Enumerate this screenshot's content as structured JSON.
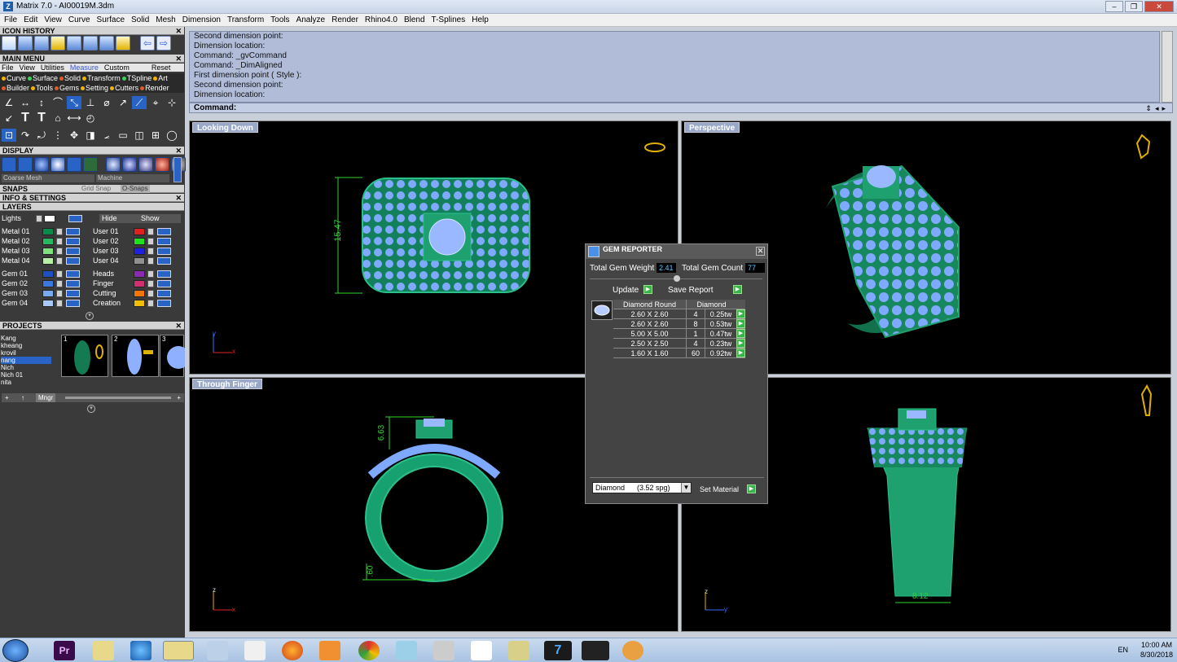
{
  "app": {
    "title": "Matrix 7.0 - AI00019M.3dm",
    "icon": "Z"
  },
  "menu": [
    "File",
    "Edit",
    "View",
    "Curve",
    "Surface",
    "Solid",
    "Mesh",
    "Dimension",
    "Transform",
    "Tools",
    "Analyze",
    "Render",
    "Rhino4.0",
    "Blend",
    "T-Splines",
    "Help"
  ],
  "panels": {
    "icon_history": "ICON HISTORY",
    "main_menu": "MAIN MENU",
    "display": "DISPLAY",
    "snaps": "SNAPS",
    "info": "INFO & SETTINGS",
    "layers": "LAYERS",
    "projects": "PROJECTS"
  },
  "main_menu_tabs": {
    "file": "File",
    "view": "View",
    "utilities": "Utilities",
    "measure": "Measure",
    "custom": "Custom",
    "reset": "Reset"
  },
  "main_menu_row1": [
    "Curve",
    "Surface",
    "Solid",
    "Transform",
    "TSpline",
    "Art"
  ],
  "main_menu_row2": [
    "Builder",
    "Tools",
    "Gems",
    "Setting",
    "Cutters",
    "Render"
  ],
  "display": {
    "mesh_label": "Coarse Mesh",
    "material_label": "Machine"
  },
  "snaps": {
    "grid": "Grid Snap",
    "osnaps": "O-Snaps"
  },
  "layers": {
    "lights": "Lights",
    "hide": "Hide",
    "show": "Show",
    "left": [
      {
        "name": "Metal 01",
        "color": "#0a8a4a"
      },
      {
        "name": "Metal 02",
        "color": "#28b860"
      },
      {
        "name": "Metal 03",
        "color": "#7fe07f"
      },
      {
        "name": "Metal 04",
        "color": "#b8f0a8"
      },
      {
        "name": "Gem 01",
        "color": "#2050c0"
      },
      {
        "name": "Gem 02",
        "color": "#3a78e0"
      },
      {
        "name": "Gem 03",
        "color": "#78a8f0"
      },
      {
        "name": "Gem 04",
        "color": "#a8c8f8"
      }
    ],
    "right": [
      {
        "name": "User 01",
        "color": "#e02020"
      },
      {
        "name": "User 02",
        "color": "#20e020"
      },
      {
        "name": "User 03",
        "color": "#2020e0"
      },
      {
        "name": "User 04",
        "color": "#909090"
      },
      {
        "name": "Heads",
        "color": "#8a2ab0"
      },
      {
        "name": "Finger",
        "color": "#d03070"
      },
      {
        "name": "Cutting",
        "color": "#f07800"
      },
      {
        "name": "Creation",
        "color": "#f0c000"
      }
    ]
  },
  "projects": {
    "items": [
      "Kang",
      "kheang",
      "krovil",
      "nang",
      "Nich",
      "Nich 01",
      "nita"
    ],
    "selected_index": 3,
    "thumb_numbers": [
      "1",
      "2",
      "3"
    ],
    "manager": "Mngr"
  },
  "command_history": [
    "Second dimension point:",
    "Dimension location:",
    "Command: _gvCommand",
    "Command: _DimAligned",
    "First dimension point ( Style ):",
    "Second dimension point:",
    "Dimension location:"
  ],
  "command_prompt": "Command:",
  "viewports": {
    "top_left": "Looking Down",
    "top_right": "Perspective",
    "bottom_left": "Through Finger",
    "bottom_right": ""
  },
  "dimensions": {
    "looking_down": "15.47",
    "through_top": "6.63",
    "through_bottom": ".60",
    "side_width": "8.12"
  },
  "axes": {
    "y": "y",
    "x": "x",
    "z": "z"
  },
  "gem_reporter": {
    "title": "GEM REPORTER",
    "weight_label": "Total Gem Weight",
    "weight_value": "2.41",
    "count_label": "Total Gem Count",
    "count_value": "77",
    "update": "Update",
    "save": "Save Report",
    "col_shape": "Diamond Round",
    "col_type": "Diamond",
    "rows": [
      {
        "size": "2.60 X 2.60",
        "count": "4",
        "tw": "0.25tw"
      },
      {
        "size": "2.60 X 2.60",
        "count": "8",
        "tw": "0.53tw"
      },
      {
        "size": "5.00 X 5.00",
        "count": "1",
        "tw": "0.47tw"
      },
      {
        "size": "2.50 X 2.50",
        "count": "4",
        "tw": "0.23tw"
      },
      {
        "size": "1.60 X 1.60",
        "count": "60",
        "tw": "0.92tw"
      }
    ],
    "material": "Diamond      (3.52 spg)",
    "set_material": "Set Material"
  },
  "tray": {
    "lang": "EN",
    "time": "10:00 AM",
    "date": "8/30/2018"
  },
  "colors": {
    "metal": "#1fa374",
    "gem": "#7fa8ff",
    "dim": "#31d431",
    "viewport_bg": "#000000"
  }
}
